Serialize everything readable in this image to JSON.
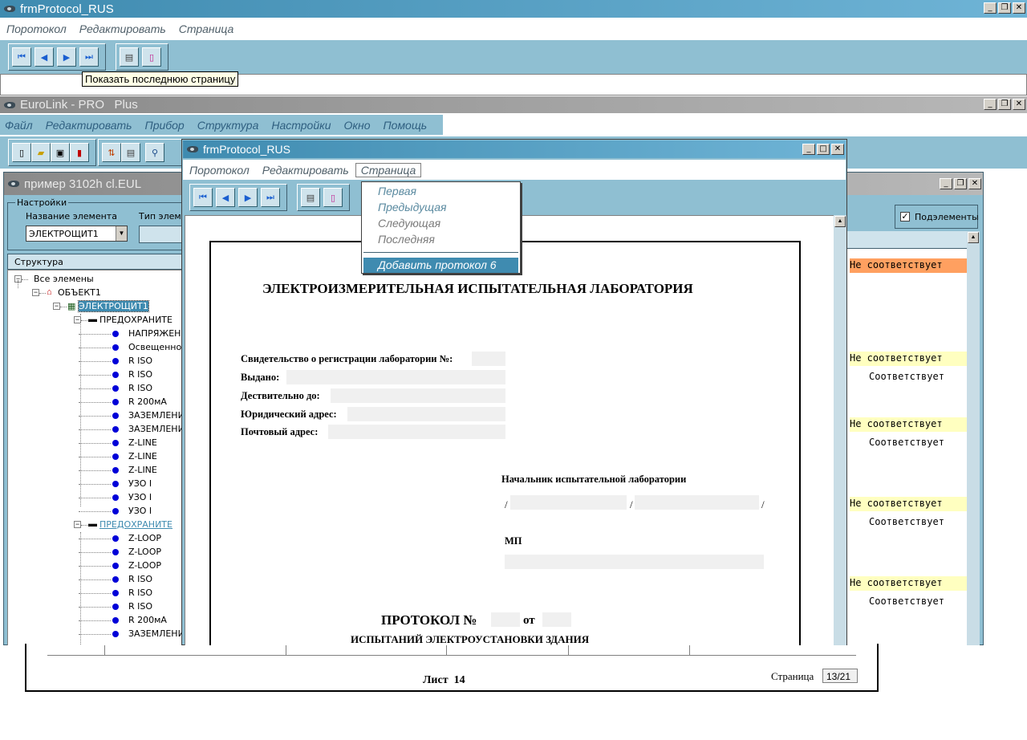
{
  "outer_window": {
    "title": "frmProtocol_RUS",
    "menu": [
      "Поротокол",
      "Редактировать",
      "Страница"
    ],
    "tooltip": "Показать последнюю страницу"
  },
  "app_window": {
    "title": "EuroLink - PRO   Plus",
    "menu": [
      "Файл",
      "Редактировать",
      "Прибор",
      "Структура",
      "Настройки",
      "Окно",
      "Помощь"
    ]
  },
  "doc_window": {
    "title": "пример 3102h cl.EUL",
    "settings_label": "Настройки",
    "element_name_label": "Название элемента",
    "element_type_label": "Тип элеме",
    "element_value": "ЭЛЕКТРОЩИТ1",
    "structure_label": "Структура",
    "subelements_label": "Подэлементы",
    "subelements_checked": true,
    "tree": [
      {
        "label": "Все элемены",
        "level": 0
      },
      {
        "label": "ОБЪЕКТ1",
        "level": 1
      },
      {
        "label": "ЭЛЕКТРОЩИТ1",
        "level": 2,
        "selected": true
      },
      {
        "label": "ПРЕДОХРАНИТЕ",
        "level": 3
      },
      {
        "label": "НАПРЯЖЕН",
        "level": 4
      },
      {
        "label": "Освещеннос",
        "level": 4
      },
      {
        "label": "R ISO",
        "level": 4
      },
      {
        "label": "R ISO",
        "level": 4
      },
      {
        "label": "R ISO",
        "level": 4
      },
      {
        "label": "R 200мА",
        "level": 4
      },
      {
        "label": "ЗАЗЕМЛЕНИ",
        "level": 4
      },
      {
        "label": "ЗАЗЕМЛЕНИ",
        "level": 4
      },
      {
        "label": "Z-LINE",
        "level": 4
      },
      {
        "label": "Z-LINE",
        "level": 4
      },
      {
        "label": "Z-LINE",
        "level": 4
      },
      {
        "label": "УЗО I",
        "level": 4
      },
      {
        "label": "УЗО I",
        "level": 4
      },
      {
        "label": "УЗО I",
        "level": 4
      },
      {
        "label": "ПРЕДОХРАНИТЕ",
        "level": 3,
        "link": true
      },
      {
        "label": "Z-LOOP",
        "level": 4
      },
      {
        "label": "Z-LOOP",
        "level": 4
      },
      {
        "label": "Z-LOOP",
        "level": 4
      },
      {
        "label": "R ISO",
        "level": 4
      },
      {
        "label": "R ISO",
        "level": 4
      },
      {
        "label": "R ISO",
        "level": 4
      },
      {
        "label": "R 200мА",
        "level": 4
      },
      {
        "label": "ЗАЗЕМЛЕНИ",
        "level": 4
      }
    ],
    "statuses": [
      {
        "fail": "Не соответствует",
        "fail_color": "#ffa060",
        "ok": ""
      },
      {
        "fail": "Не соответствует",
        "fail_color": "#ffffc0",
        "ok": "Соответствует"
      },
      {
        "fail": "Не соответствует",
        "fail_color": "#ffffc0",
        "ok": "Соответствует"
      },
      {
        "fail": "Не соответствует",
        "fail_color": "#ffffc0",
        "ok": "Соответствует"
      },
      {
        "fail": "Не соответствует",
        "fail_color": "#ffffc0",
        "ok": "Соответствует"
      }
    ]
  },
  "protocol_window": {
    "title": "frmProtocol_RUS",
    "menu": [
      "Поротокол",
      "Редактировать",
      "Страница"
    ],
    "page_menu": {
      "items": [
        {
          "label": "Первая",
          "enabled": true
        },
        {
          "label": "Предыдущая",
          "enabled": true
        },
        {
          "label": "Следующая",
          "enabled": false
        },
        {
          "label": "Последняя",
          "enabled": false
        }
      ],
      "highlighted": "Добавить протокол 6"
    },
    "document": {
      "heading": "ЭЛЕКТРОИЗМЕРИТЕЛЬНАЯ ИСПЫТАТЕЛЬНАЯ ЛАБОРАТОРИЯ",
      "fields": [
        "Свидетельство о регистрации лаборатории №:",
        "Выдано:",
        "Дествительно до:",
        "Юридический адрес:",
        "Почтовый адрес:"
      ],
      "head_label": "Начальник испытательной лаборатории",
      "slash": "/",
      "mp_label": "МП",
      "protocol_no": "ПРОТОКОЛ №",
      "protocol_from": "от",
      "protocol_subtitle": "ИСПЫТАНИЙ ЭЛЕКТРОУСТАНОВКИ ЗДАНИЯ"
    }
  },
  "bottom_page": {
    "sheet_label": "Лист  14",
    "page_label": "Страница",
    "page_value": "13/21"
  }
}
